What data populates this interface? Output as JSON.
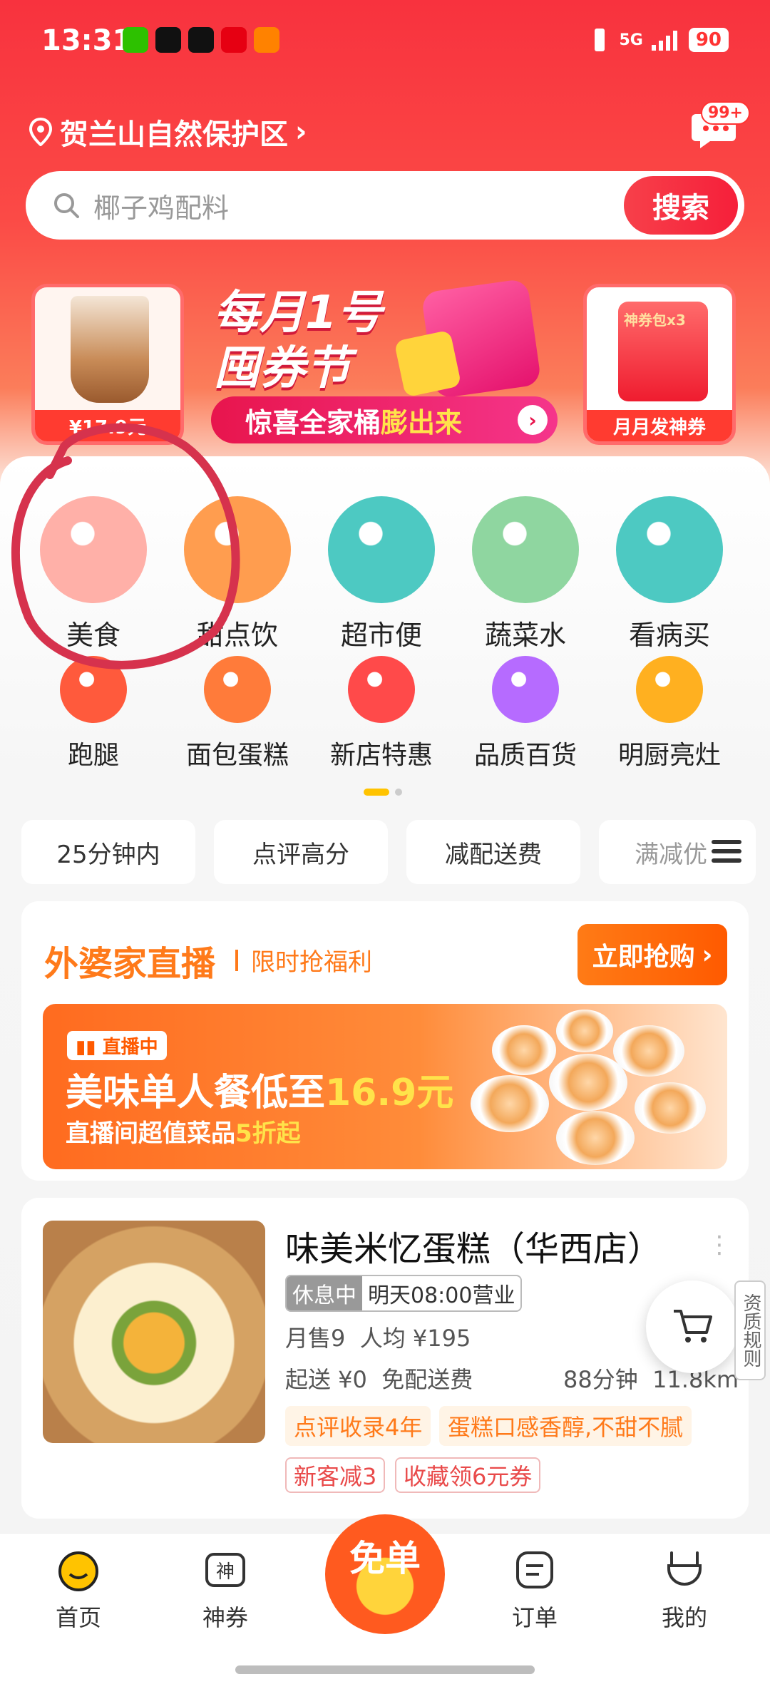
{
  "status_bar": {
    "time": "13:31",
    "network": "5G",
    "battery": "90"
  },
  "header": {
    "location": "贺兰山自然保护区",
    "message_badge": "99+",
    "search_placeholder": "椰子鸡配料",
    "search_button": "搜索"
  },
  "banners": {
    "left_tag": "¥17.9元",
    "promo_title_1": "每月1号",
    "promo_title_2": "囤券节",
    "promo_sub_prefix": "惊喜全家桶",
    "promo_sub_highlight": "膨出来",
    "right_envelope": "神券包x3",
    "right_tag": "月月发神券"
  },
  "categories_row1": [
    {
      "label": "美食",
      "icon": "fork-spoon-icon",
      "color": "#ffb0a8"
    },
    {
      "label": "甜点饮品",
      "icon": "drink-icon",
      "color": "#ff9d4f"
    },
    {
      "label": "超市便利",
      "icon": "shopping-basket-icon",
      "color": "#4dc9c2"
    },
    {
      "label": "蔬菜水果",
      "icon": "peach-icon",
      "color": "#8fd6a0"
    },
    {
      "label": "看病买药",
      "icon": "medicine-box-icon",
      "color": "#4dc9c2"
    }
  ],
  "categories_row2": [
    {
      "label": "跑腿",
      "icon": "runner-icon",
      "color": "#ff5a3c"
    },
    {
      "label": "面包蛋糕",
      "icon": "donut-icon",
      "color": "#ff7b3a"
    },
    {
      "label": "新店特惠",
      "icon": "discount-tag-icon",
      "color": "#ff4a4a"
    },
    {
      "label": "品质百货",
      "icon": "shopping-bag-icon",
      "color": "#b66bff"
    },
    {
      "label": "明厨亮灶",
      "icon": "camera-icon",
      "color": "#ffb020"
    }
  ],
  "filter_chips": [
    "25分钟内",
    "点评高分",
    "减配送费",
    "满减优"
  ],
  "live": {
    "title": "外婆家直播",
    "subtitle": "限时抢福利",
    "button": "立即抢购",
    "badge": "直播中",
    "headline_prefix": "美味单人餐低至",
    "headline_price": "16.9元",
    "sub_prefix": "直播间超值菜品",
    "sub_highlight": "5折起"
  },
  "store": {
    "name": "味美米忆蛋糕（华西店）",
    "status": "休息中",
    "open_time": "明天08:00营业",
    "monthly_sales": "月售9",
    "avg_price": "人均 ¥195",
    "min_order": "起送 ¥0",
    "delivery": "免配送费",
    "time": "88分钟",
    "distance": "11.8km",
    "tags": [
      "点评收录4年",
      "蛋糕口感香醇,不甜不腻"
    ],
    "coupons": [
      "新客减3",
      "收藏领6元券"
    ],
    "side_note": "资质规则"
  },
  "bottom_nav": [
    {
      "label": "首页",
      "icon": "home-icon"
    },
    {
      "label": "神券",
      "icon": "coupon-icon"
    },
    {
      "label": "免单",
      "icon": "free-order-icon"
    },
    {
      "label": "订单",
      "icon": "order-icon"
    },
    {
      "label": "我的",
      "icon": "profile-icon"
    }
  ],
  "colors": {
    "primary_red": "#f8323e",
    "accent_orange": "#ff7a1a",
    "highlight_yellow": "#ffc300"
  }
}
